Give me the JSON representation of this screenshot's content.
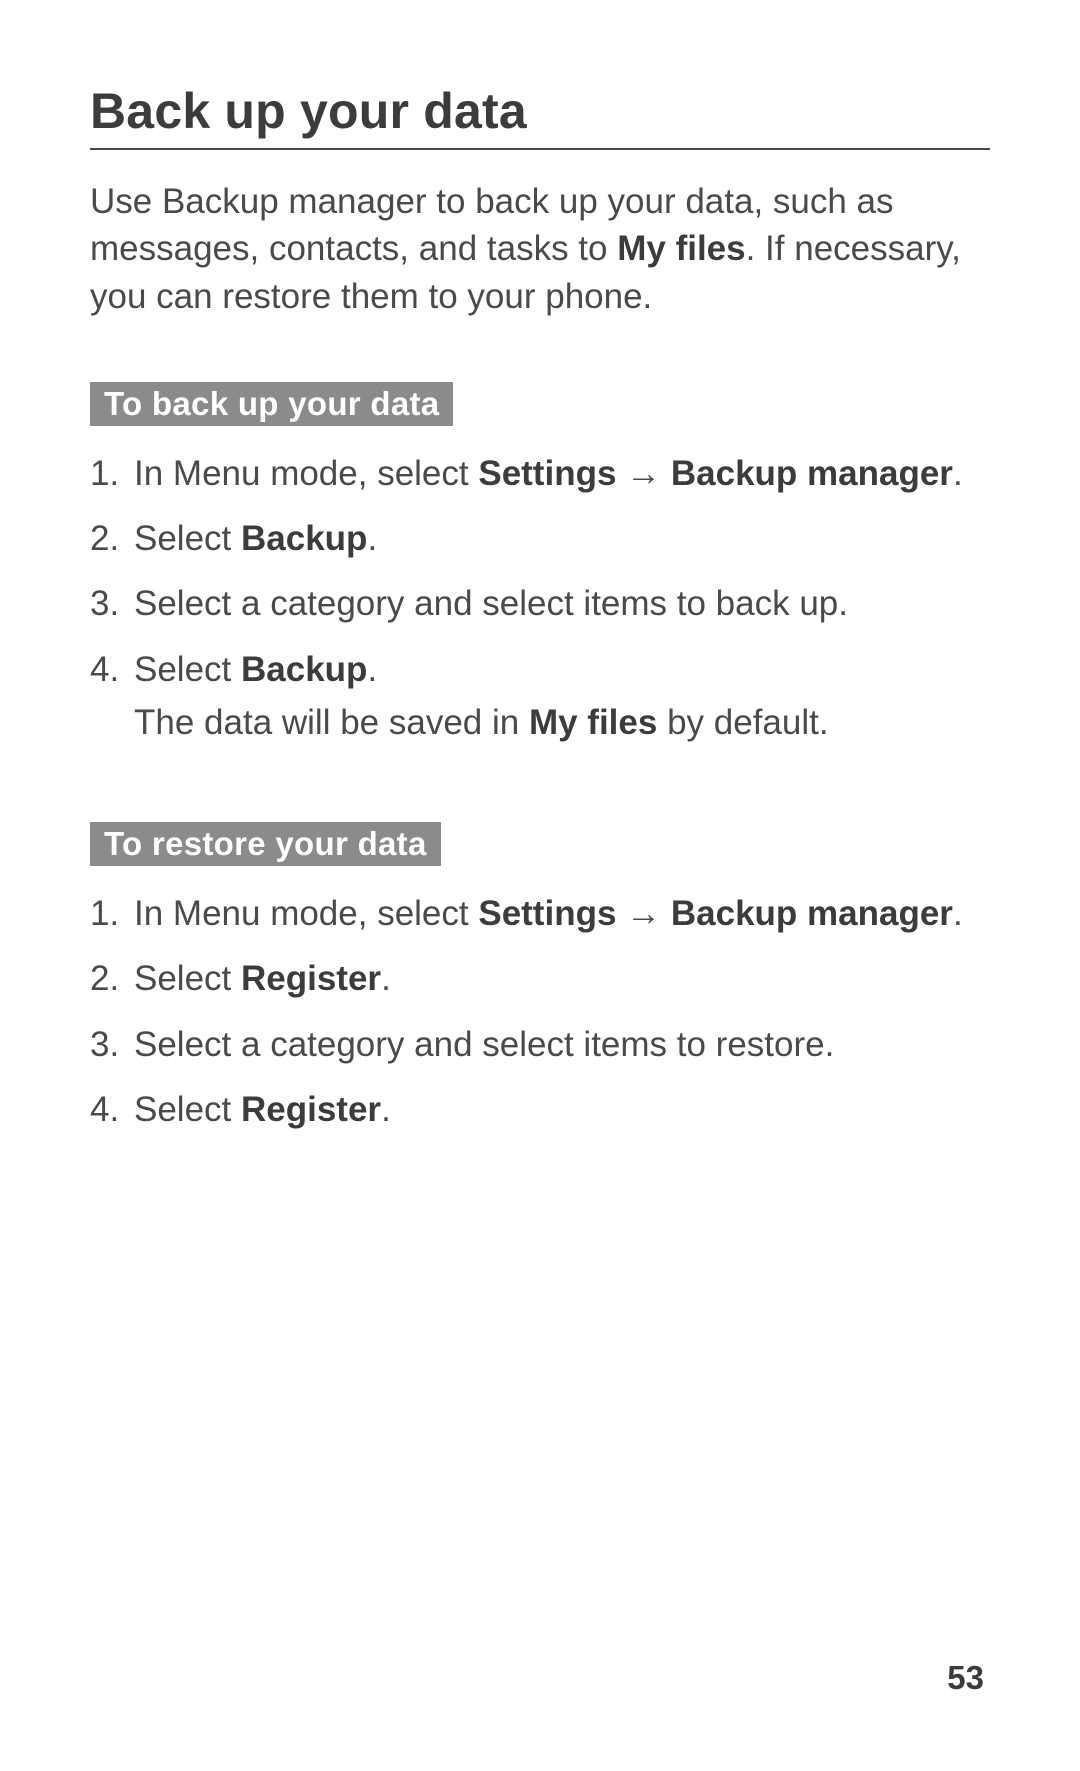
{
  "title": "Back up your data",
  "intro": {
    "part1": "Use Backup manager to back up your data, such as messages, contacts, and tasks to ",
    "bold1": "My files",
    "part2": ". If necessary, you can restore them to your phone."
  },
  "section1": {
    "heading": "To back up your data",
    "steps": [
      {
        "p1": "In Menu mode, select ",
        "b1": "Settings",
        "arrow": " → ",
        "b2": "Backup manager",
        "p2": "."
      },
      {
        "p1": "Select ",
        "b1": "Backup",
        "p2": "."
      },
      {
        "p1": "Select a category and select items to back up."
      },
      {
        "p1": "Select ",
        "b1": "Backup",
        "p2": ".",
        "sub_p1": "The data will be saved in ",
        "sub_b1": "My files",
        "sub_p2": " by default."
      }
    ]
  },
  "section2": {
    "heading": "To restore your data",
    "steps": [
      {
        "p1": "In Menu mode, select ",
        "b1": "Settings",
        "arrow": " → ",
        "b2": "Backup manager",
        "p2": "."
      },
      {
        "p1": "Select ",
        "b1": "Register",
        "p2": "."
      },
      {
        "p1": "Select a category and select items to restore."
      },
      {
        "p1": "Select ",
        "b1": "Register",
        "p2": "."
      }
    ]
  },
  "page_number": "53"
}
